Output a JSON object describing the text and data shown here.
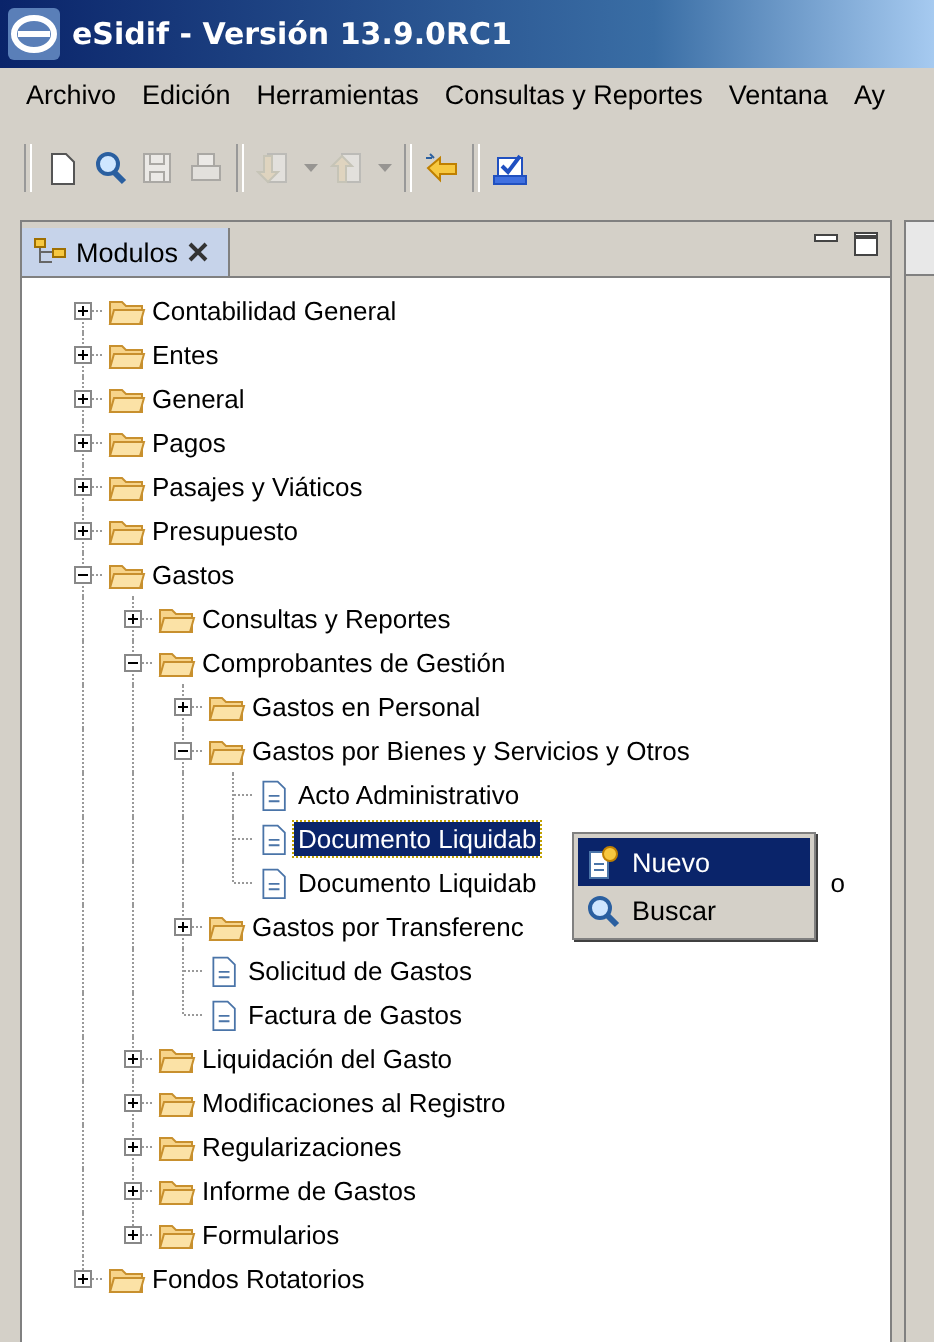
{
  "window": {
    "title": "eSidif - Versión 13.9.0RC1"
  },
  "menu_bar": [
    {
      "label": "Archivo"
    },
    {
      "label": "Edición"
    },
    {
      "label": "Herramientas"
    },
    {
      "label": "Consultas y Reportes"
    },
    {
      "label": "Ventana"
    },
    {
      "label": "Ay"
    }
  ],
  "toolbar": [
    {
      "kind": "separator"
    },
    {
      "kind": "new",
      "disabled": false
    },
    {
      "kind": "search",
      "disabled": false
    },
    {
      "kind": "save",
      "disabled": true
    },
    {
      "kind": "print",
      "disabled": true
    },
    {
      "kind": "separator"
    },
    {
      "kind": "import",
      "disabled": true
    },
    {
      "kind": "caret",
      "disabled": true
    },
    {
      "kind": "export",
      "disabled": true
    },
    {
      "kind": "caret",
      "disabled": true
    },
    {
      "kind": "separator"
    },
    {
      "kind": "back",
      "disabled": false
    },
    {
      "kind": "separator"
    },
    {
      "kind": "checklist",
      "disabled": false
    }
  ],
  "panel": {
    "tab": {
      "label": "Modulos",
      "selected": true
    }
  },
  "tree": [
    {
      "label": "Contabilidad General",
      "kind": "folder",
      "expanded": false,
      "selected": false
    },
    {
      "label": "Entes",
      "kind": "folder",
      "expanded": false,
      "selected": false
    },
    {
      "label": "General",
      "kind": "folder",
      "expanded": false,
      "selected": false
    },
    {
      "label": "Pagos",
      "kind": "folder",
      "expanded": false,
      "selected": false
    },
    {
      "label": "Pasajes y Viáticos",
      "kind": "folder",
      "expanded": false,
      "selected": false
    },
    {
      "label": "Presupuesto",
      "kind": "folder",
      "expanded": false,
      "selected": false
    },
    {
      "label": "Gastos",
      "kind": "folder",
      "expanded": true,
      "selected": false,
      "children": [
        {
          "label": "Consultas y Reportes",
          "kind": "folder",
          "expanded": false,
          "selected": false
        },
        {
          "label": "Comprobantes de Gestión",
          "kind": "folder",
          "expanded": true,
          "selected": false,
          "children": [
            {
              "label": "Gastos en Personal",
              "kind": "folder",
              "expanded": false,
              "selected": false
            },
            {
              "label": "Gastos por Bienes y Servicios y Otros",
              "kind": "folder",
              "expanded": true,
              "selected": false,
              "children": [
                {
                  "label": "Acto Administrativo",
                  "kind": "document",
                  "selected": false
                },
                {
                  "label": "Documento Liquidab",
                  "kind": "document",
                  "selected": true
                },
                {
                  "label": "Documento Liquidab",
                  "tail": "o",
                  "kind": "document",
                  "selected": false
                }
              ]
            },
            {
              "label": "Gastos por Transferenc",
              "kind": "folder",
              "expanded": false,
              "selected": false
            },
            {
              "label": "Solicitud de Gastos",
              "kind": "document",
              "selected": false
            },
            {
              "label": "Factura de Gastos",
              "kind": "document",
              "selected": false
            }
          ]
        },
        {
          "label": "Liquidación del Gasto",
          "kind": "folder",
          "expanded": false,
          "selected": false
        },
        {
          "label": "Modificaciones al Registro",
          "kind": "folder",
          "expanded": false,
          "selected": false
        },
        {
          "label": "Regularizaciones",
          "kind": "folder",
          "expanded": false,
          "selected": false
        },
        {
          "label": "Informe de Gastos",
          "kind": "folder",
          "expanded": false,
          "selected": false
        },
        {
          "label": "Formularios",
          "kind": "folder",
          "expanded": false,
          "selected": false
        }
      ]
    },
    {
      "label": "Fondos Rotatorios",
      "kind": "folder",
      "expanded": false,
      "selected": false
    }
  ],
  "context_menu": [
    {
      "label": "Nuevo",
      "selected": true
    },
    {
      "label": "Buscar",
      "selected": false
    }
  ]
}
